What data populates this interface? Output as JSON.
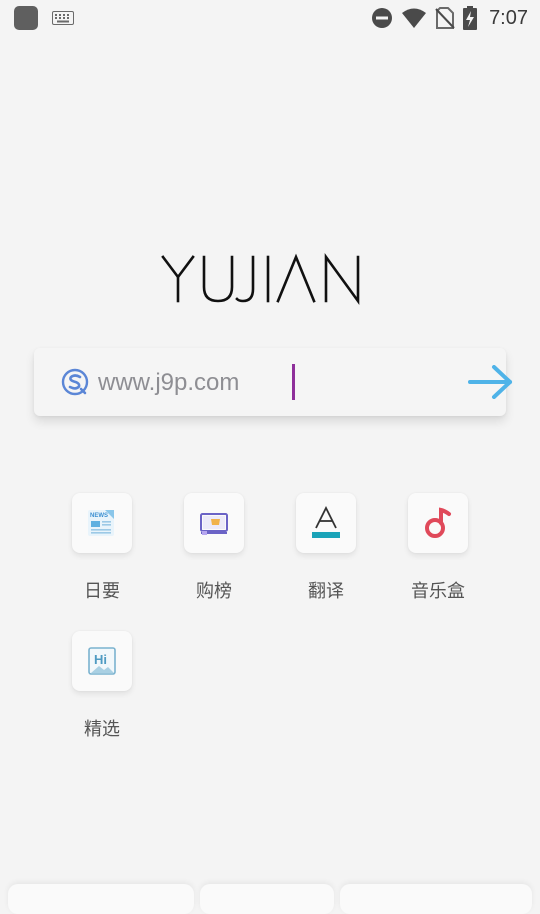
{
  "status_bar": {
    "time": "7:07"
  },
  "logo": {
    "text": "YUJIAN"
  },
  "search": {
    "value": "www.j9p.com",
    "go_icon": "arrow-right-icon",
    "engine_icon": "sogou-icon"
  },
  "shortcuts": [
    {
      "label": "日要",
      "icon": "news-icon"
    },
    {
      "label": "购榜",
      "icon": "shopping-rank-icon"
    },
    {
      "label": "翻译",
      "icon": "translate-icon"
    },
    {
      "label": "音乐盒",
      "icon": "music-note-icon"
    },
    {
      "label": "精选",
      "icon": "featured-hi-icon"
    }
  ],
  "colors": {
    "background": "#f4f4f4",
    "arrow": "#4fb3e8",
    "caret": "#8e2f9a",
    "music": "#e0495a",
    "translate_bar": "#1aa3b8",
    "sogou": "#5b86d6"
  }
}
